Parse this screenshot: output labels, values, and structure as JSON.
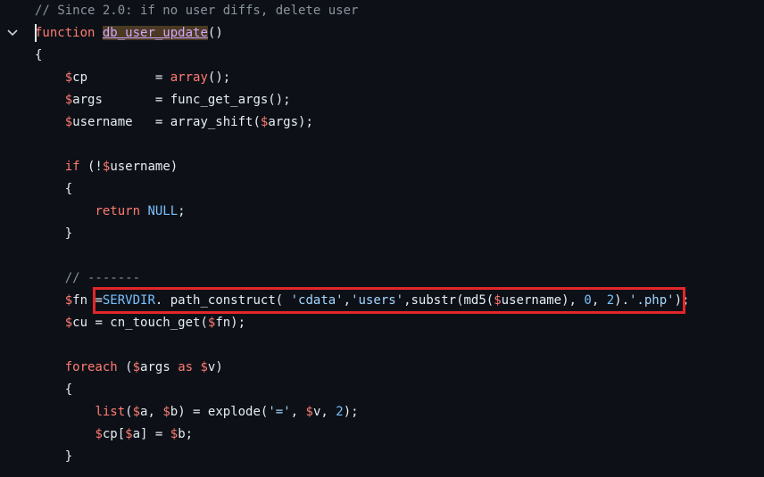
{
  "editor": {
    "fold_icon": "chevron-down-icon",
    "highlight_color": "#e3262b",
    "lines": [
      [
        {
          "c": "t-comment",
          "t": "// Since 2.0: if no user diffs, delete user"
        }
      ],
      [
        {
          "c": "t-keyword",
          "t": "function"
        },
        {
          "c": "t-plain",
          "t": " "
        },
        {
          "c": "t-hlname",
          "t": "db_user_update"
        },
        {
          "c": "t-plain",
          "t": "()"
        }
      ],
      [
        {
          "c": "t-plain",
          "t": "{"
        }
      ],
      [
        {
          "c": "t-plain",
          "t": "    "
        },
        {
          "c": "t-dollar",
          "t": "$"
        },
        {
          "c": "t-var",
          "t": "cp"
        },
        {
          "c": "t-plain",
          "t": "         = "
        },
        {
          "c": "t-keyword",
          "t": "array"
        },
        {
          "c": "t-plain",
          "t": "();"
        }
      ],
      [
        {
          "c": "t-plain",
          "t": "    "
        },
        {
          "c": "t-dollar",
          "t": "$"
        },
        {
          "c": "t-var",
          "t": "args"
        },
        {
          "c": "t-plain",
          "t": "       = func_get_args();"
        }
      ],
      [
        {
          "c": "t-plain",
          "t": "    "
        },
        {
          "c": "t-dollar",
          "t": "$"
        },
        {
          "c": "t-var",
          "t": "username"
        },
        {
          "c": "t-plain",
          "t": "   = array_shift("
        },
        {
          "c": "t-dollar",
          "t": "$"
        },
        {
          "c": "t-var",
          "t": "args"
        },
        {
          "c": "t-plain",
          "t": ");"
        }
      ],
      [],
      [
        {
          "c": "t-plain",
          "t": "    "
        },
        {
          "c": "t-keyword",
          "t": "if"
        },
        {
          "c": "t-plain",
          "t": " (!"
        },
        {
          "c": "t-dollar",
          "t": "$"
        },
        {
          "c": "t-var",
          "t": "username"
        },
        {
          "c": "t-plain",
          "t": ")"
        }
      ],
      [
        {
          "c": "t-plain",
          "t": "    {"
        }
      ],
      [
        {
          "c": "t-plain",
          "t": "        "
        },
        {
          "c": "t-keyword",
          "t": "return"
        },
        {
          "c": "t-plain",
          "t": " "
        },
        {
          "c": "t-const",
          "t": "NULL"
        },
        {
          "c": "t-plain",
          "t": ";"
        }
      ],
      [
        {
          "c": "t-plain",
          "t": "    }"
        }
      ],
      [],
      [
        {
          "c": "t-plain",
          "t": "    "
        },
        {
          "c": "t-comment",
          "t": "// -------"
        }
      ],
      [
        {
          "c": "t-plain",
          "t": "    "
        },
        {
          "c": "t-dollar",
          "t": "$"
        },
        {
          "c": "t-var",
          "t": "fn"
        },
        {
          "c": "t-plain",
          "t": " ="
        },
        {
          "c": "t-const",
          "t": "SERVDIR"
        },
        {
          "c": "t-plain",
          "t": ". path_construct( "
        },
        {
          "c": "t-str",
          "t": "'cdata'"
        },
        {
          "c": "t-plain",
          "t": ","
        },
        {
          "c": "t-str",
          "t": "'users'"
        },
        {
          "c": "t-plain",
          "t": ",substr(md5("
        },
        {
          "c": "t-dollar",
          "t": "$"
        },
        {
          "c": "t-var",
          "t": "username"
        },
        {
          "c": "t-plain",
          "t": "), "
        },
        {
          "c": "t-num",
          "t": "0"
        },
        {
          "c": "t-plain",
          "t": ", "
        },
        {
          "c": "t-num",
          "t": "2"
        },
        {
          "c": "t-plain",
          "t": ")."
        },
        {
          "c": "t-str",
          "t": "'.php'"
        },
        {
          "c": "t-plain",
          "t": ");"
        }
      ],
      [
        {
          "c": "t-plain",
          "t": "    "
        },
        {
          "c": "t-dollar",
          "t": "$"
        },
        {
          "c": "t-var",
          "t": "cu"
        },
        {
          "c": "t-plain",
          "t": " = cn_touch_get("
        },
        {
          "c": "t-dollar",
          "t": "$"
        },
        {
          "c": "t-var",
          "t": "fn"
        },
        {
          "c": "t-plain",
          "t": ");"
        }
      ],
      [],
      [
        {
          "c": "t-plain",
          "t": "    "
        },
        {
          "c": "t-keyword",
          "t": "foreach"
        },
        {
          "c": "t-plain",
          "t": " ("
        },
        {
          "c": "t-dollar",
          "t": "$"
        },
        {
          "c": "t-var",
          "t": "args"
        },
        {
          "c": "t-plain",
          "t": " "
        },
        {
          "c": "t-keyword",
          "t": "as"
        },
        {
          "c": "t-plain",
          "t": " "
        },
        {
          "c": "t-dollar",
          "t": "$"
        },
        {
          "c": "t-var",
          "t": "v"
        },
        {
          "c": "t-plain",
          "t": ")"
        }
      ],
      [
        {
          "c": "t-plain",
          "t": "    {"
        }
      ],
      [
        {
          "c": "t-plain",
          "t": "        "
        },
        {
          "c": "t-keyword",
          "t": "list"
        },
        {
          "c": "t-plain",
          "t": "("
        },
        {
          "c": "t-dollar",
          "t": "$"
        },
        {
          "c": "t-var",
          "t": "a"
        },
        {
          "c": "t-plain",
          "t": ", "
        },
        {
          "c": "t-dollar",
          "t": "$"
        },
        {
          "c": "t-var",
          "t": "b"
        },
        {
          "c": "t-plain",
          "t": ") = explode("
        },
        {
          "c": "t-str",
          "t": "'='"
        },
        {
          "c": "t-plain",
          "t": ", "
        },
        {
          "c": "t-dollar",
          "t": "$"
        },
        {
          "c": "t-var",
          "t": "v"
        },
        {
          "c": "t-plain",
          "t": ", "
        },
        {
          "c": "t-num",
          "t": "2"
        },
        {
          "c": "t-plain",
          "t": ");"
        }
      ],
      [
        {
          "c": "t-plain",
          "t": "        "
        },
        {
          "c": "t-dollar",
          "t": "$"
        },
        {
          "c": "t-var",
          "t": "cp"
        },
        {
          "c": "t-plain",
          "t": "["
        },
        {
          "c": "t-dollar",
          "t": "$"
        },
        {
          "c": "t-var",
          "t": "a"
        },
        {
          "c": "t-plain",
          "t": "] = "
        },
        {
          "c": "t-dollar",
          "t": "$"
        },
        {
          "c": "t-var",
          "t": "b"
        },
        {
          "c": "t-plain",
          "t": ";"
        }
      ],
      [
        {
          "c": "t-plain",
          "t": "    }"
        }
      ]
    ]
  }
}
